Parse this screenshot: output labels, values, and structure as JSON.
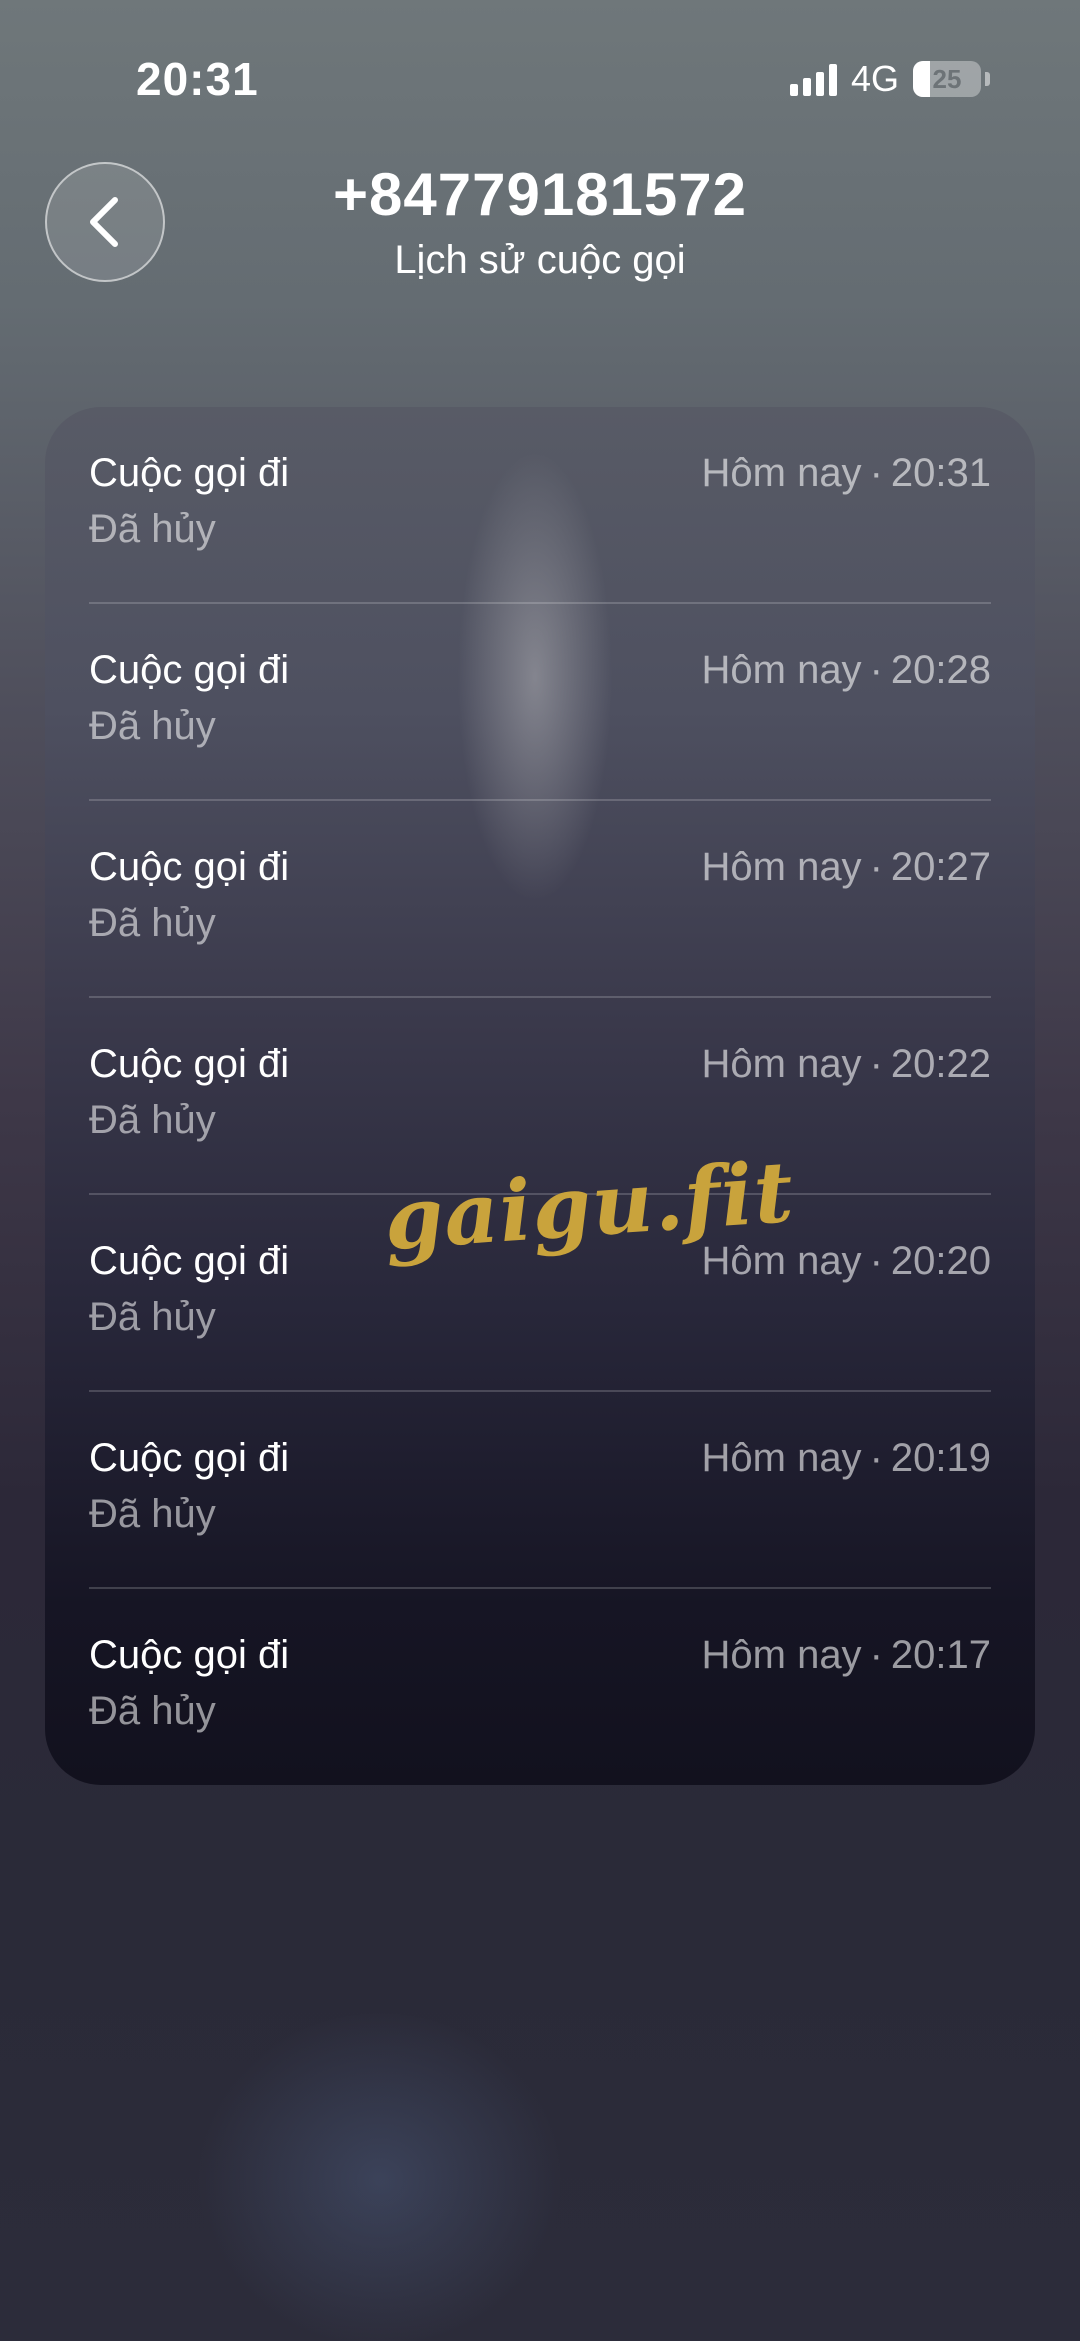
{
  "status_bar": {
    "time": "20:31",
    "network": "4G",
    "battery": "25",
    "battery_level": 0.25
  },
  "header": {
    "title": "+84779181572",
    "subtitle": "Lịch sử cuộc gọi"
  },
  "calls": [
    {
      "type": "Cuộc gọi đi",
      "status": "Đã hủy",
      "day": "Hôm nay",
      "time": "20:31"
    },
    {
      "type": "Cuộc gọi đi",
      "status": "Đã hủy",
      "day": "Hôm nay",
      "time": "20:28"
    },
    {
      "type": "Cuộc gọi đi",
      "status": "Đã hủy",
      "day": "Hôm nay",
      "time": "20:27"
    },
    {
      "type": "Cuộc gọi đi",
      "status": "Đã hủy",
      "day": "Hôm nay",
      "time": "20:22"
    },
    {
      "type": "Cuộc gọi đi",
      "status": "Đã hủy",
      "day": "Hôm nay",
      "time": "20:20"
    },
    {
      "type": "Cuộc gọi đi",
      "status": "Đã hủy",
      "day": "Hôm nay",
      "time": "20:19"
    },
    {
      "type": "Cuộc gọi đi",
      "status": "Đã hủy",
      "day": "Hôm nay",
      "time": "20:17"
    }
  ],
  "watermark": "gaigu.fit"
}
